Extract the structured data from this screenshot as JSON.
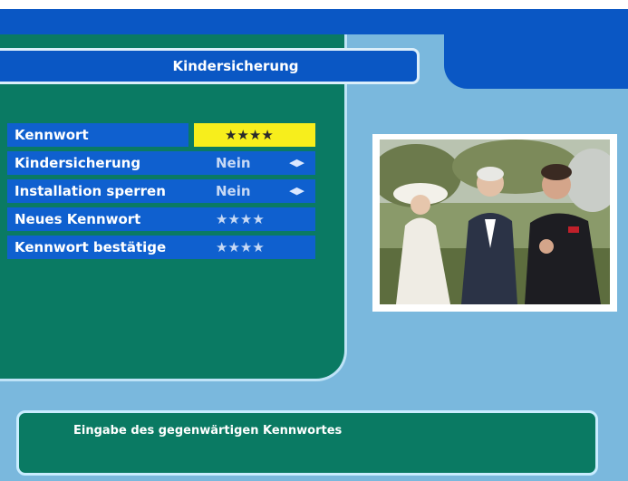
{
  "menu": {
    "title": "Kindersicherung",
    "rows": [
      {
        "label": "Kennwort",
        "value": "★★★★",
        "arrows": ""
      },
      {
        "label": "Kindersicherung",
        "value": "Nein",
        "arrows": "◀▶"
      },
      {
        "label": "Installation sperren",
        "value": "Nein",
        "arrows": "◀▶"
      },
      {
        "label": "Neues Kennwort",
        "value": "★★★★",
        "arrows": ""
      },
      {
        "label": "Kennwort bestätige",
        "value": "★★★★",
        "arrows": ""
      }
    ]
  },
  "help": {
    "text": "Eingabe des gegenwärtigen Kennwortes"
  },
  "colors": {
    "header_blue": "#0a57c4",
    "panel_green": "#0a7a63",
    "highlight_yellow": "#f7ee1c",
    "background_blue": "#7ab8dd"
  }
}
